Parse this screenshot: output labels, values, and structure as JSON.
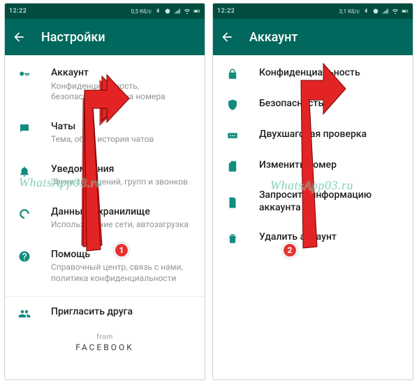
{
  "screens": {
    "left": {
      "status": {
        "time": "12:22",
        "net": "0,5 Кб/с"
      },
      "header": {
        "title": "Настройки"
      },
      "items": [
        {
          "title": "Аккаунт",
          "sub": "Конфиденциальность, безопасность, смена номера"
        },
        {
          "title": "Чаты",
          "sub": "Тема, обои, история чатов"
        },
        {
          "title": "Уведомления",
          "sub": "Звуки сообщений, групп и звонков"
        },
        {
          "title": "Данные и хранилище",
          "sub": "Использование сети, автозагрузка"
        },
        {
          "title": "Помощь",
          "sub": "Справочный центр, связь с нами, политика конфиденциальности"
        },
        {
          "title": "Пригласить друга",
          "sub": ""
        }
      ],
      "footer": {
        "from": "from",
        "brand": "FACEBOOK"
      }
    },
    "right": {
      "status": {
        "time": "12:22",
        "net": "3,1 Кб/с"
      },
      "header": {
        "title": "Аккаунт"
      },
      "items": [
        {
          "title": "Конфиденциальность"
        },
        {
          "title": "Безопасность"
        },
        {
          "title": "Двухшаговая проверка"
        },
        {
          "title": "Изменить номер"
        },
        {
          "title": "Запросить информацию аккаунта"
        },
        {
          "title": "Удалить аккаунт"
        }
      ]
    }
  },
  "annotations": {
    "badge1": "1",
    "badge2": "2",
    "watermark": "WhatsApp03.ru"
  }
}
